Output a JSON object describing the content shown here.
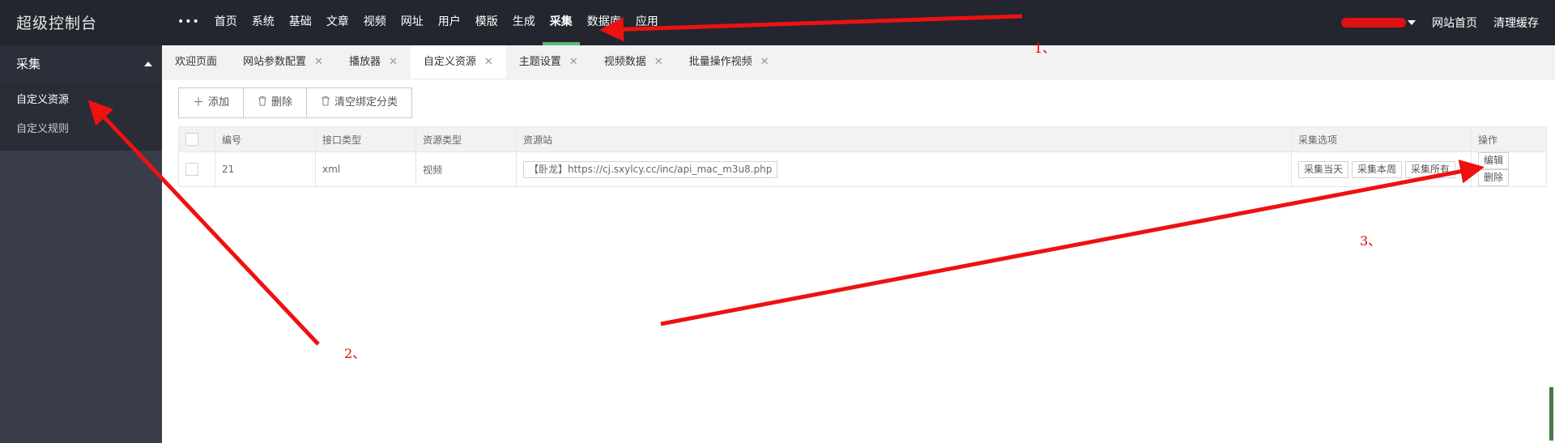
{
  "app_title": "超级控制台",
  "nav": {
    "more": "•••",
    "items": [
      "首页",
      "系统",
      "基础",
      "文章",
      "视频",
      "网址",
      "用户",
      "模版",
      "生成",
      "采集",
      "数据库",
      "应用"
    ],
    "active_index": 9
  },
  "top_right": {
    "site_home": "网站首页",
    "clear_cache": "清理缓存"
  },
  "sidebar": {
    "group": "采集",
    "items": [
      "自定义资源",
      "自定义规则"
    ],
    "active_index": 0
  },
  "tabs": [
    {
      "label": "欢迎页面",
      "closable": false
    },
    {
      "label": "网站参数配置",
      "closable": true
    },
    {
      "label": "播放器",
      "closable": true
    },
    {
      "label": "自定义资源",
      "closable": true,
      "active": true
    },
    {
      "label": "主题设置",
      "closable": true
    },
    {
      "label": "视频数据",
      "closable": true
    },
    {
      "label": "批量操作视频",
      "closable": true
    }
  ],
  "tab_close_glyph": "✕",
  "toolbar": {
    "add": "添加",
    "delete": "删除",
    "clear_bind": "清空绑定分类"
  },
  "table": {
    "headers": [
      "编号",
      "接口类型",
      "资源类型",
      "资源站",
      "采集选项",
      "操作"
    ],
    "rows": [
      {
        "id": "21",
        "api_type": "xml",
        "res_type": "视频",
        "site": "【卧龙】https://cj.sxylcy.cc/inc/api_mac_m3u8.php",
        "collect_options": [
          "采集当天",
          "采集本周",
          "采集所有"
        ],
        "actions": [
          "编辑",
          "删除"
        ]
      }
    ]
  },
  "annotations": [
    "1、",
    "2、",
    "3、"
  ],
  "colors": {
    "topbar_bg": "#23262e",
    "sidebar_bg": "#393d49",
    "nav_active_underline": "#5fb878",
    "annotation_red": "#ee1111"
  }
}
